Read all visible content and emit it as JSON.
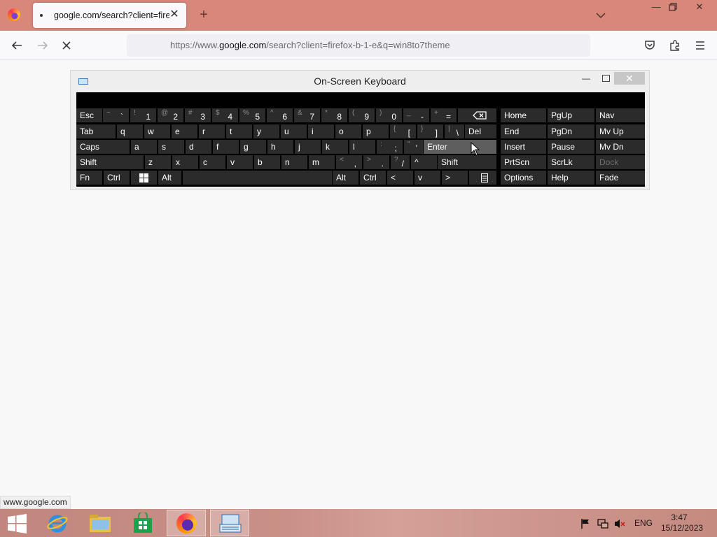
{
  "browser": {
    "tab_title": "google.com/search?client=firef",
    "url_prefix": "https://www.",
    "url_domain": "google.com",
    "url_suffix": "/search?client=firefox-b-1-e&q=win8to7theme",
    "status_url": "www.google.com"
  },
  "osk": {
    "title": "On-Screen Keyboard",
    "rows": [
      {
        "keys": [
          {
            "label": "Esc"
          },
          {
            "shift": "~",
            "main": "`"
          },
          {
            "shift": "!",
            "main": "1"
          },
          {
            "shift": "@",
            "main": "2"
          },
          {
            "shift": "#",
            "main": "3"
          },
          {
            "shift": "$",
            "main": "4"
          },
          {
            "shift": "%",
            "main": "5"
          },
          {
            "shift": "^",
            "main": "6"
          },
          {
            "shift": "&",
            "main": "7"
          },
          {
            "shift": "*",
            "main": "8"
          },
          {
            "shift": "(",
            "main": "9"
          },
          {
            "shift": ")",
            "main": "0"
          },
          {
            "shift": "_",
            "main": "-"
          },
          {
            "shift": "+",
            "main": "="
          },
          {
            "icon": "backspace-icon"
          }
        ]
      },
      {
        "keys": [
          {
            "label": "Tab"
          },
          {
            "label": "q"
          },
          {
            "label": "w"
          },
          {
            "label": "e"
          },
          {
            "label": "r"
          },
          {
            "label": "t"
          },
          {
            "label": "y"
          },
          {
            "label": "u"
          },
          {
            "label": "i"
          },
          {
            "label": "o"
          },
          {
            "label": "p"
          },
          {
            "shift": "{",
            "main": "["
          },
          {
            "shift": "}",
            "main": "]"
          },
          {
            "shift": "|",
            "main": "\\"
          },
          {
            "label": "Del"
          }
        ]
      },
      {
        "keys": [
          {
            "label": "Caps"
          },
          {
            "label": "a"
          },
          {
            "label": "s"
          },
          {
            "label": "d"
          },
          {
            "label": "f"
          },
          {
            "label": "g"
          },
          {
            "label": "h"
          },
          {
            "label": "j"
          },
          {
            "label": "k"
          },
          {
            "label": "l"
          },
          {
            "shift": ":",
            "main": ";"
          },
          {
            "shift": "\"",
            "main": "'"
          },
          {
            "label": "Enter"
          }
        ]
      },
      {
        "keys": [
          {
            "label": "Shift"
          },
          {
            "label": "z"
          },
          {
            "label": "x"
          },
          {
            "label": "c"
          },
          {
            "label": "v"
          },
          {
            "label": "b"
          },
          {
            "label": "n"
          },
          {
            "label": "m"
          },
          {
            "shift": "<",
            "main": ","
          },
          {
            "shift": ">",
            "main": "."
          },
          {
            "shift": "?",
            "main": "/"
          },
          {
            "label": "^"
          },
          {
            "label": "Shift"
          }
        ]
      },
      {
        "keys": [
          {
            "label": "Fn"
          },
          {
            "label": "Ctrl"
          },
          {
            "icon": "windows-icon"
          },
          {
            "label": "Alt"
          },
          {
            "label": ""
          },
          {
            "label": "Alt"
          },
          {
            "label": "Ctrl"
          },
          {
            "label": "<"
          },
          {
            "label": "v"
          },
          {
            "label": ">"
          },
          {
            "icon": "menu-icon"
          }
        ]
      }
    ],
    "nav_rows": [
      [
        "Home",
        "PgUp",
        "Nav"
      ],
      [
        "End",
        "PgDn",
        "Mv Up"
      ],
      [
        "Insert",
        "Pause",
        "Mv Dn"
      ],
      [
        "PrtScn",
        "ScrLk",
        "Dock"
      ],
      [
        "Options",
        "Help",
        "Fade"
      ]
    ]
  },
  "taskbar": {
    "language": "ENG",
    "time": "3:47",
    "date": "15/12/2023"
  }
}
